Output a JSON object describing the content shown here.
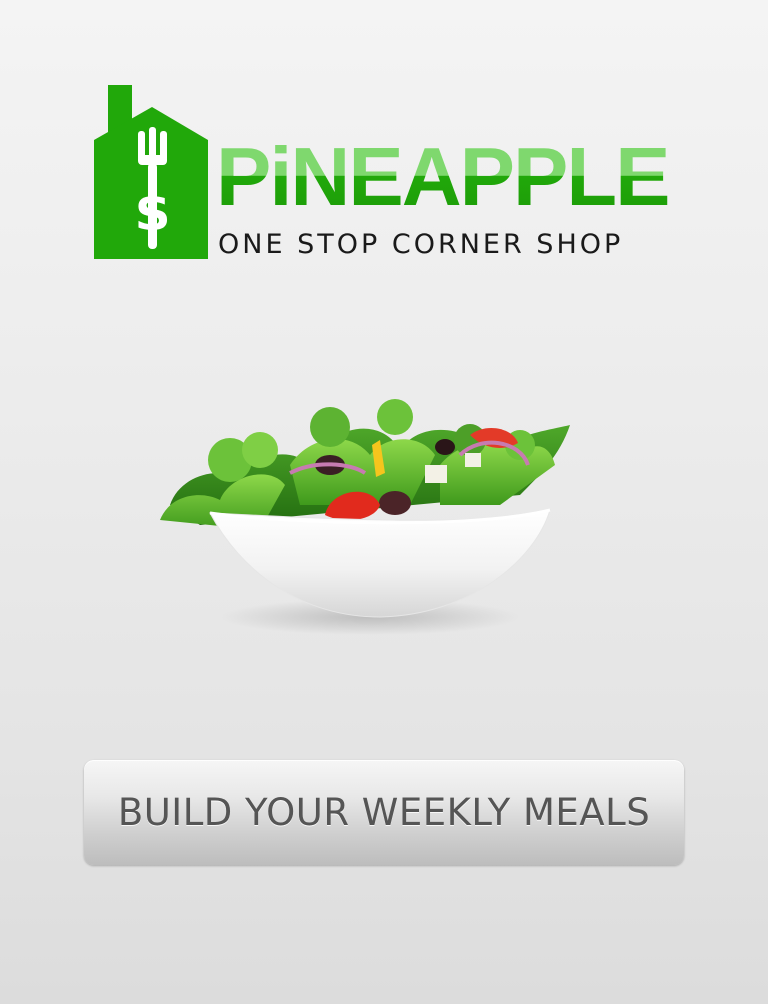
{
  "brand": {
    "name": "PiNEAPPLE",
    "tagline": "ONE STOP CORNER SHOP",
    "logo_symbol": "$",
    "logo_icon": "house-fork-dollar-icon",
    "primary_color": "#21a80a",
    "highlight_color": "#7fd86e"
  },
  "hero": {
    "image": "salad-bowl-image"
  },
  "cta": {
    "label": "BUILD YOUR WEEKLY MEALS"
  }
}
